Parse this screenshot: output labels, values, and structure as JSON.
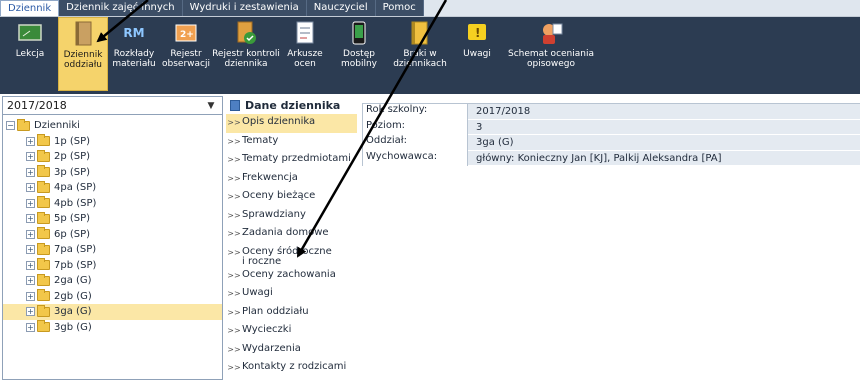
{
  "menu": {
    "tabs": [
      {
        "label": "Dziennik"
      },
      {
        "label": "Dziennik zajęć innych"
      },
      {
        "label": "Wydruki i zestawienia"
      },
      {
        "label": "Nauczyciel"
      },
      {
        "label": "Pomoc"
      }
    ]
  },
  "ribbon": {
    "buttons": [
      {
        "label": "Lekcja",
        "icon": "chalkboard-icon"
      },
      {
        "label": "Dziennik\noddziału",
        "icon": "journal-book-icon"
      },
      {
        "label": "Rozkłady\nmateriału",
        "icon": "rm-icon"
      },
      {
        "label": "Rejestr\nobserwacji",
        "icon": "register-icon"
      },
      {
        "label": "Rejestr kontroli\ndziennika",
        "icon": "check-book-icon"
      },
      {
        "label": "Arkusze\nocen",
        "icon": "grade-sheet-icon"
      },
      {
        "label": "Dostęp\nmobilny",
        "icon": "mobile-icon"
      },
      {
        "label": "Braki w\ndziennikach",
        "icon": "missing-book-icon"
      },
      {
        "label": "Uwagi",
        "icon": "warning-icon"
      },
      {
        "label": "Schemat oceniania\nopisowego",
        "icon": "assessment-scheme-icon"
      }
    ],
    "rm_text": "RM",
    "register_text": "2+"
  },
  "left": {
    "year_select": "2017/2018",
    "root_label": "Dzienniki",
    "classes": [
      "1p (SP)",
      "2p (SP)",
      "3p (SP)",
      "4pa (SP)",
      "4pb (SP)",
      "5p (SP)",
      "6p (SP)",
      "7pa (SP)",
      "7pb (SP)",
      "2ga (G)",
      "2gb (G)",
      "3ga (G)",
      "3gb (G)"
    ],
    "selected": "3ga (G)"
  },
  "mid": {
    "title": "Dane dziennika",
    "items": [
      {
        "label": "Opis dziennika"
      },
      {
        "label": "Tematy"
      },
      {
        "label": "Tematy przedmiotami"
      },
      {
        "label": "Frekwencja"
      },
      {
        "label": "Oceny bieżące"
      },
      {
        "label": "Sprawdziany"
      },
      {
        "label": "Zadania domowe"
      },
      {
        "label": "Oceny śródroczne\ni roczne"
      },
      {
        "label": "Oceny zachowania"
      },
      {
        "label": "Uwagi"
      },
      {
        "label": "Plan oddziału"
      },
      {
        "label": "Wycieczki"
      },
      {
        "label": "Wydarzenia"
      },
      {
        "label": "Kontakty z rodzicami"
      }
    ]
  },
  "details": {
    "rows": [
      {
        "label": "Rok szkolny:",
        "value": "2017/2018"
      },
      {
        "label": "Poziom:",
        "value": "3"
      },
      {
        "label": "Oddział:",
        "value": "3ga (G)"
      },
      {
        "label": "Wychowawca:",
        "value": "główny: Konieczny Jan [KJ], Palkij Aleksandra [PA]"
      }
    ]
  },
  "colors": {
    "active_highlight": "#f5d36b",
    "ribbon_bg": "#2c3c52",
    "selection": "#fbe7a6"
  }
}
